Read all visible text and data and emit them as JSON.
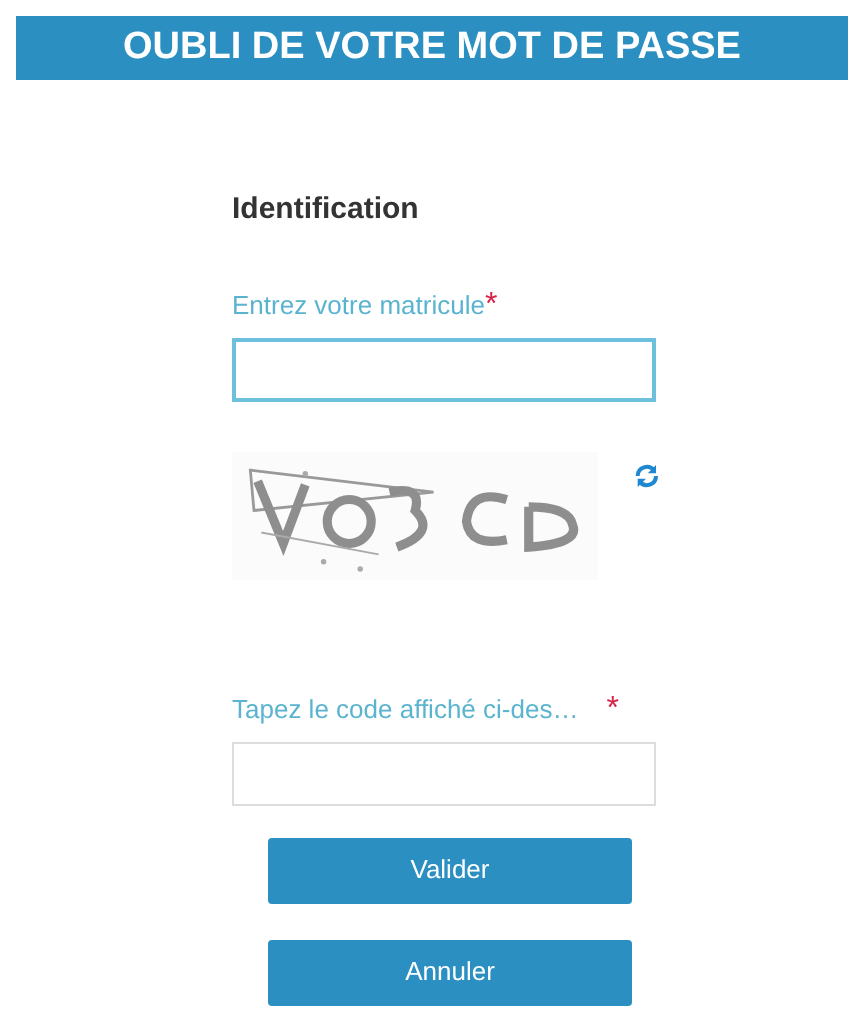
{
  "header": {
    "title": "OUBLI DE VOTRE MOT DE PASSE"
  },
  "section_title": "Identification",
  "fields": [
    {
      "kind": "text",
      "label": "Entrez votre matricule",
      "required_mark": "*",
      "focused": true
    },
    {
      "kind": "captcha",
      "label": "Tapez le code affiché ci-des…",
      "required_mark": "*",
      "focused": false
    }
  ],
  "buttons": [
    "Valider",
    "Annuler"
  ]
}
